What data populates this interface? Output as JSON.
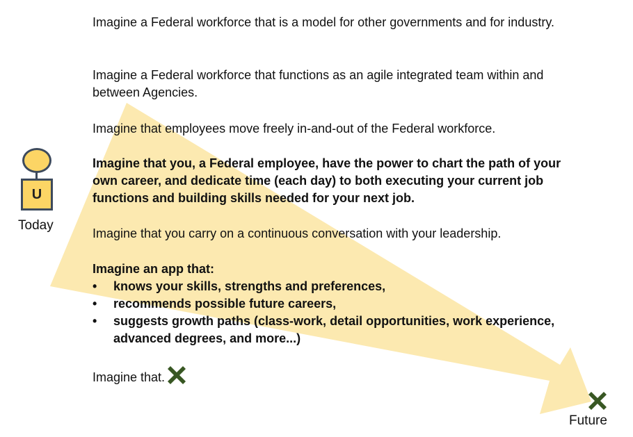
{
  "paragraphs": {
    "p1": "Imagine a Federal workforce that is a model for other governments and for industry.",
    "p2": "Imagine a Federal workforce that functions as an agile integrated team within and between Agencies.",
    "p3": "Imagine that employees move freely in-and-out of the Federal workforce.",
    "p4": "Imagine that you, a Federal employee, have the power to chart the path of your own career, and dedicate time (each day) to both executing your current job functions and building skills needed for your next job.",
    "p5": "Imagine that you carry on a continuous conversation with your leadership.",
    "app_intro": "Imagine an app that:",
    "app_features": [
      "knows your skills, strengths and preferences,",
      "recommends possible future careers,",
      "suggests growth paths (class-work, detail opportunities, work experience, advanced degrees, and more...)"
    ],
    "p7": "Imagine that."
  },
  "bullet_char": "•",
  "avatar": {
    "letter": "U",
    "label": "Today"
  },
  "destination": {
    "label": "Future"
  },
  "colors": {
    "arrow": "#fce9b0",
    "avatar_fill": "#fcd565",
    "avatar_outline": "#3d4a5c",
    "x_mark": "#385723"
  },
  "icons": [
    "person-avatar-icon",
    "x-mark-icon"
  ]
}
